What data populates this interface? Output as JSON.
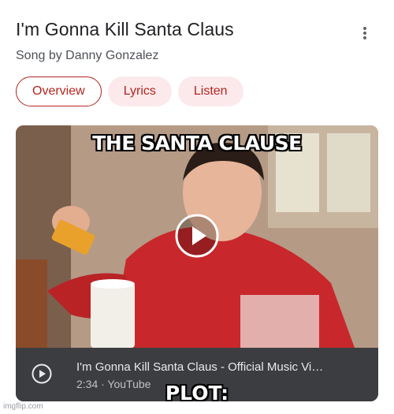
{
  "header": {
    "title": "I'm Gonna Kill Santa Claus",
    "subtitle": "Song by Danny Gonzalez"
  },
  "tabs": [
    {
      "label": "Overview",
      "active": true
    },
    {
      "label": "Lyrics",
      "active": false
    },
    {
      "label": "Listen",
      "active": false
    }
  ],
  "video": {
    "title": "I'm Gonna Kill Santa Claus - Official Music Vi…",
    "meta": "2:34 · YouTube"
  },
  "meme": {
    "top_caption": "THE SANTA CLAUSE",
    "bottom_caption": "PLOT:"
  },
  "watermark": "imgflip.com",
  "colors": {
    "accent": "#b3261e",
    "tab_bg": "#fbe9ec",
    "bar_bg": "#3c3d40"
  },
  "icons": [
    "more-vert-icon",
    "play-circle-icon"
  ]
}
